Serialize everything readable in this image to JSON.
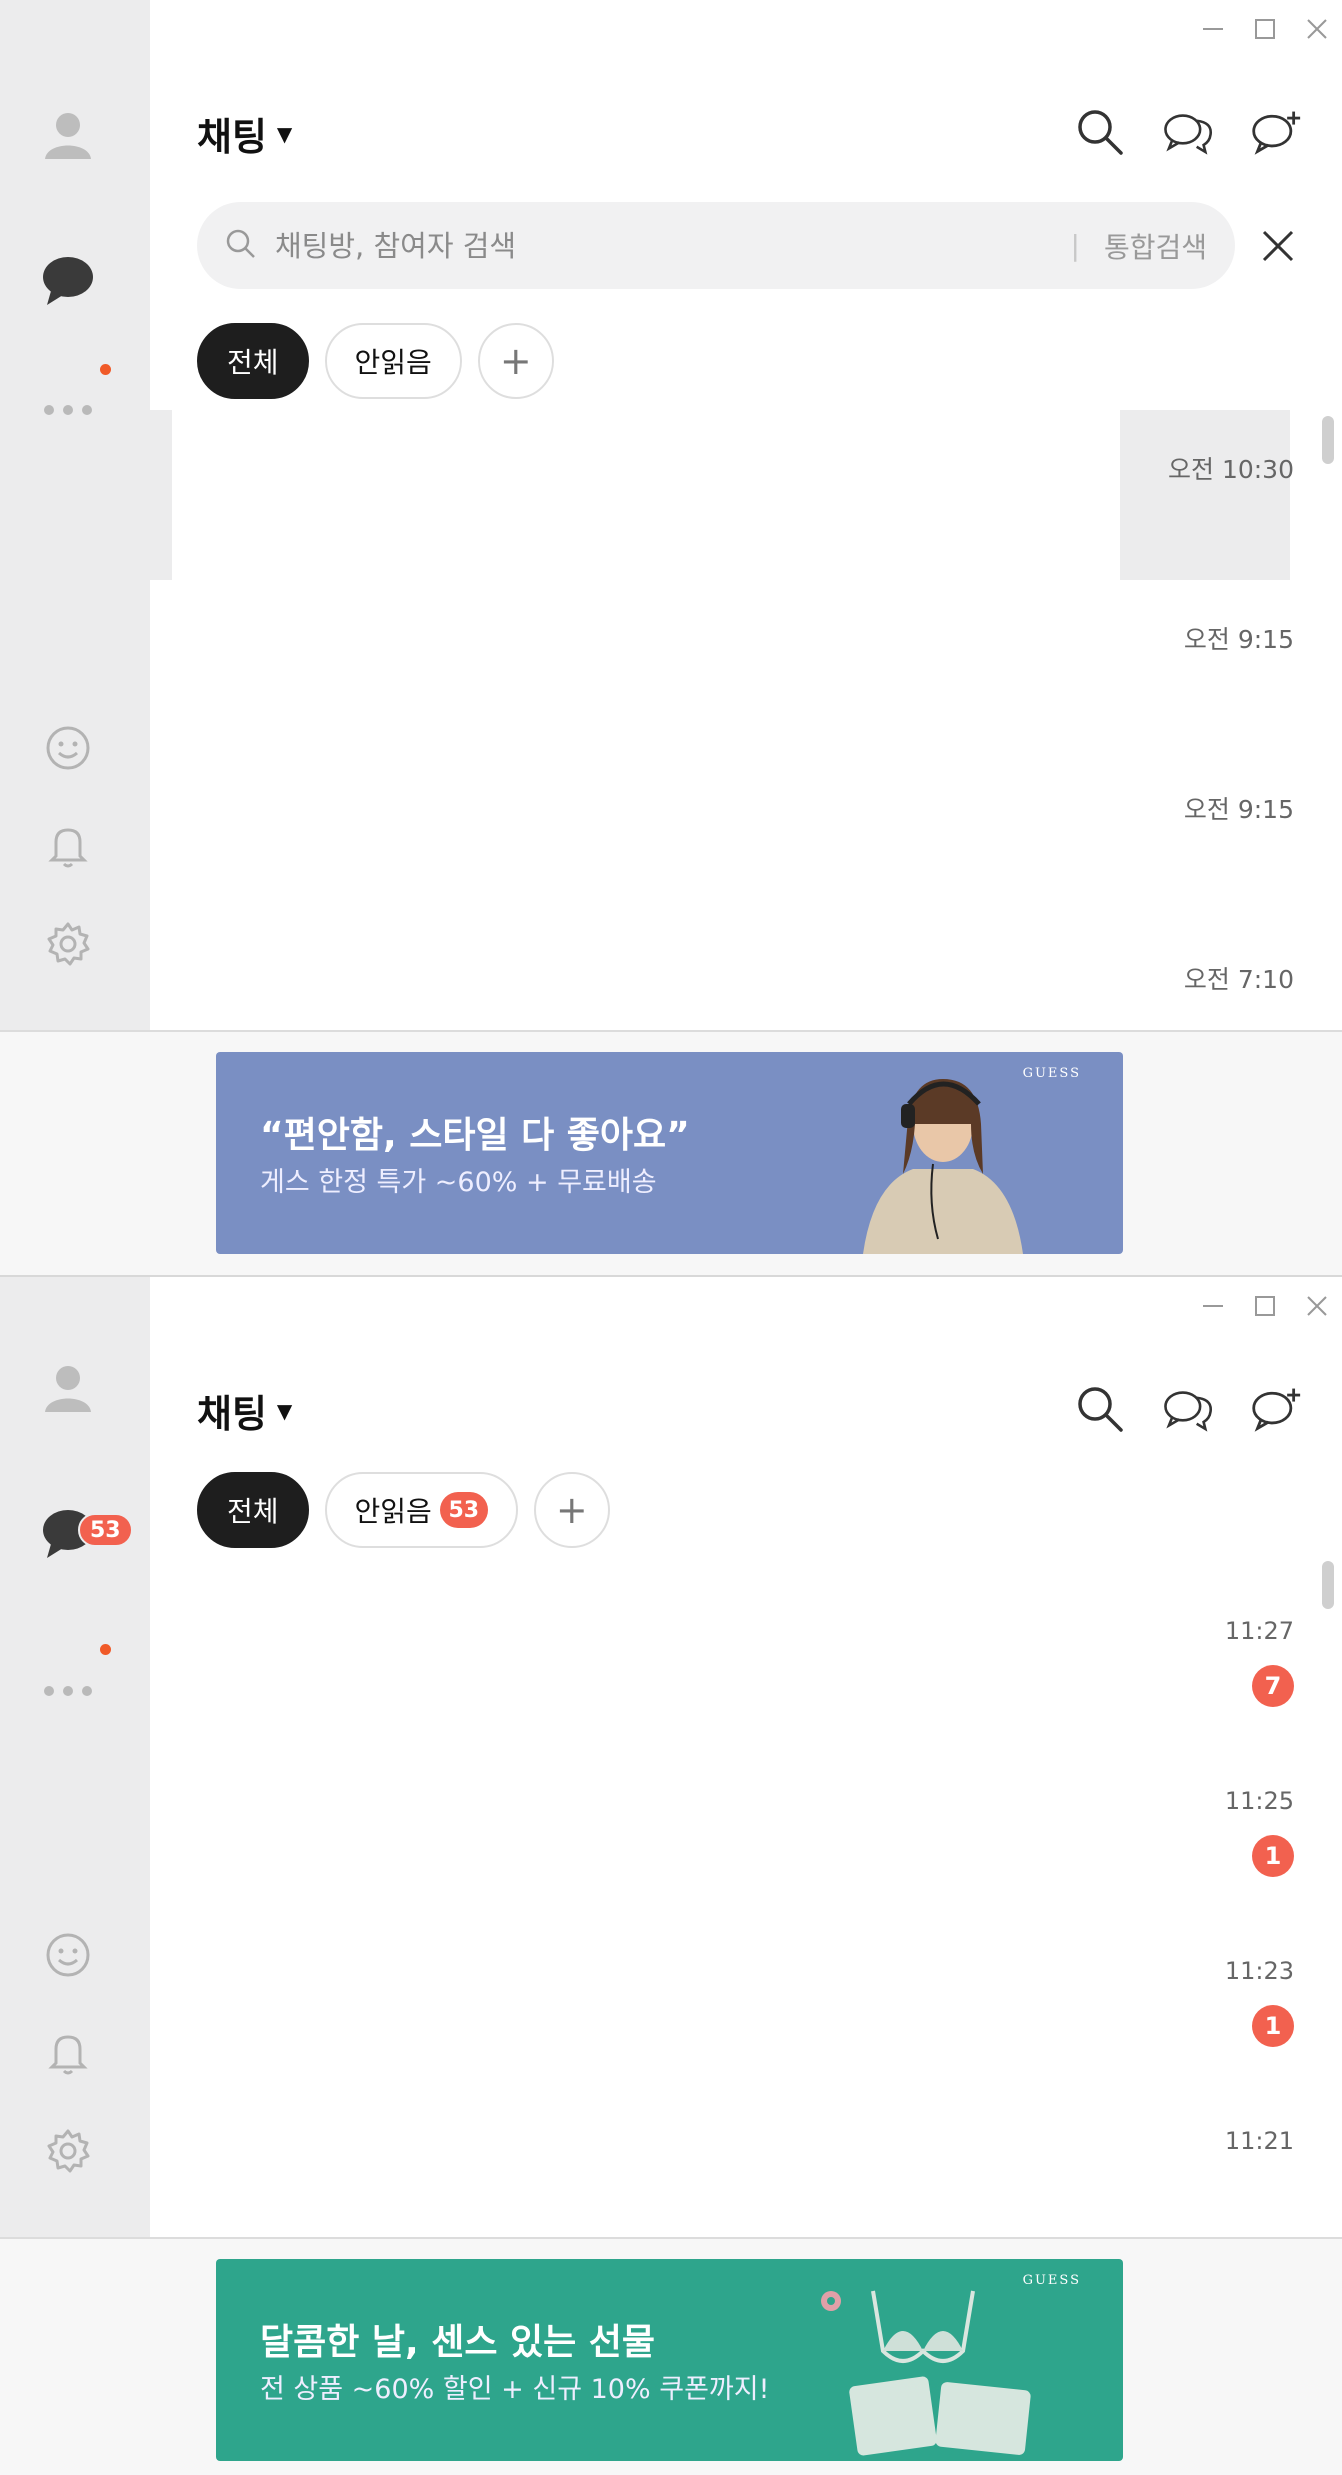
{
  "window_controls": [
    "minimize",
    "maximize",
    "close"
  ],
  "top_window": {
    "title": "채팅",
    "search": {
      "placeholder": "채팅방, 참여자 검색",
      "all_search_label": "통합검색"
    },
    "filters": {
      "all": "전체",
      "unread": "안읽음",
      "add": "+"
    },
    "rows": [
      {
        "time": "오전 10:30",
        "selected": true
      },
      {
        "time": "오전 9:15"
      },
      {
        "time": "오전 9:15"
      },
      {
        "time": "오전 7:10"
      }
    ],
    "ad": {
      "headline": "“편안함, 스타일 다 좋아요”",
      "sub": "게스 한정 특가 ~60% + 무료배송",
      "brand": "GUESS",
      "bg": "#7a8fc3"
    }
  },
  "bottom_window": {
    "title": "채팅",
    "sidebar_chat_badge": "53",
    "filters": {
      "all": "전체",
      "unread": "안읽음",
      "unread_count": "53",
      "add": "+"
    },
    "rows": [
      {
        "time": "11:27",
        "unread": "7"
      },
      {
        "time": "11:25",
        "unread": "1"
      },
      {
        "time": "11:23",
        "unread": "1"
      },
      {
        "time": "11:21"
      }
    ],
    "ad": {
      "headline": "달콤한 날, 센스 있는 선물",
      "sub": "전 상품 ~60% 할인 + 신규 10% 쿠폰까지!",
      "brand": "GUESS",
      "bg": "#2ea58c"
    }
  },
  "colors": {
    "accent_badge": "#f2614f",
    "sidebar_bg": "#ececed",
    "active_chip": "#1e1e1e"
  }
}
